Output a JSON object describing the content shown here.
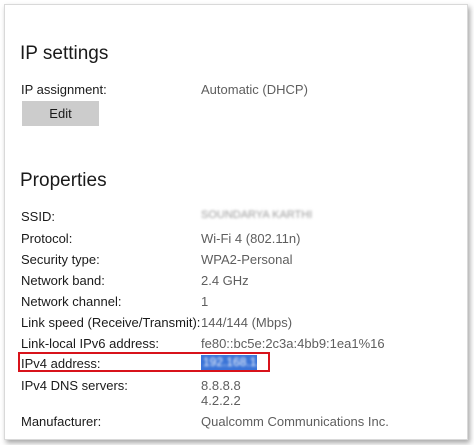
{
  "ip_settings": {
    "title": "IP settings",
    "assignment_label": "IP assignment:",
    "assignment_value": "Automatic (DHCP)",
    "edit_label": "Edit"
  },
  "properties": {
    "title": "Properties",
    "rows": [
      {
        "label": "SSID:",
        "value": "SOUNDARYA KARTHI",
        "redacted": true
      },
      {
        "label": "Protocol:",
        "value": "Wi-Fi 4 (802.11n)"
      },
      {
        "label": "Security type:",
        "value": "WPA2-Personal"
      },
      {
        "label": "Network band:",
        "value": "2.4 GHz"
      },
      {
        "label": "Network channel:",
        "value": "1"
      },
      {
        "label": "Link speed (Receive/Transmit):",
        "value": "144/144 (Mbps)"
      },
      {
        "label": "Link-local IPv6 address:",
        "value": "fe80::bc5e:2c3a:4bb9:1ea1%16"
      },
      {
        "label": "IPv4 address:",
        "value": "192.168.1.9",
        "redacted": true,
        "selected": true
      },
      {
        "label": "IPv4 DNS servers:",
        "value": "8.8.8.8",
        "value2": "4.2.2.2"
      },
      {
        "label": "Manufacturer:",
        "value": "Qualcomm Communications Inc."
      }
    ]
  },
  "colors": {
    "highlight_border": "#d8131b",
    "selection": "#3a74d8",
    "button_bg": "#cccccc"
  }
}
